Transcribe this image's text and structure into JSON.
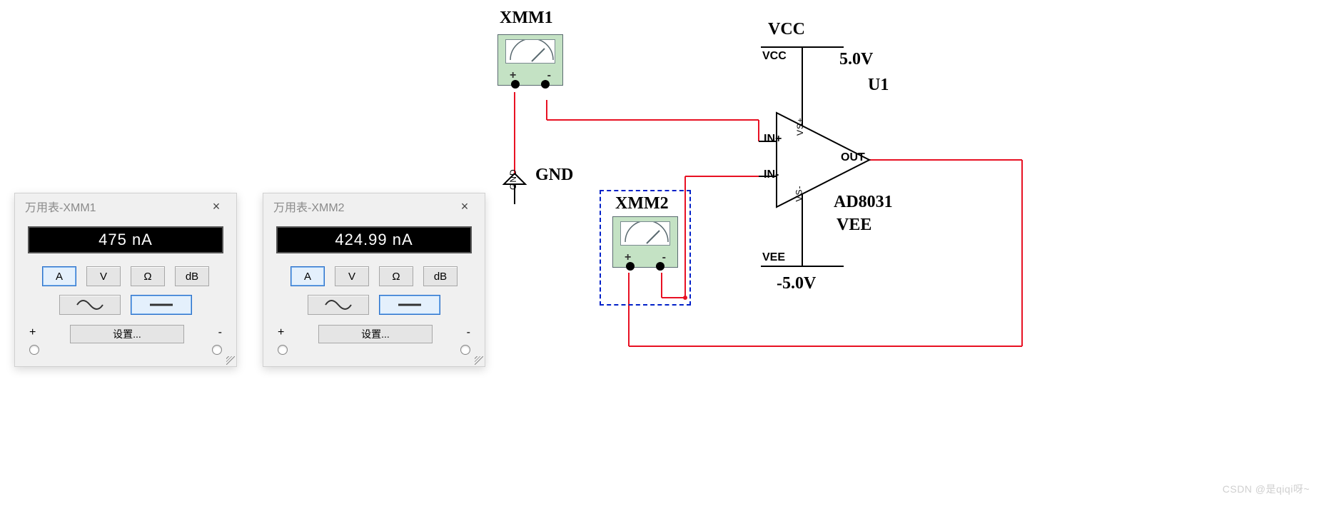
{
  "meters": [
    {
      "key": "xmm1",
      "title": "万用表-XMM1",
      "display": "475 nA",
      "btns_top": [
        "A",
        "V",
        "Ω",
        "dB"
      ],
      "btns_top_active": 0,
      "btns_mode_active": 1,
      "settings_label": "设置...",
      "term_plus": "+",
      "term_minus": "-",
      "close_glyph": "×"
    },
    {
      "key": "xmm2",
      "title": "万用表-XMM2",
      "display": "424.99 nA",
      "btns_top": [
        "A",
        "V",
        "Ω",
        "dB"
      ],
      "btns_top_active": 0,
      "btns_mode_active": 1,
      "settings_label": "设置...",
      "term_plus": "+",
      "term_minus": "-",
      "close_glyph": "×"
    }
  ],
  "circuit": {
    "instr1_label": "XMM1",
    "instr2_label": "XMM2",
    "gnd_label": "GND",
    "gnd_net": "GND",
    "opamp_ref": "U1",
    "opamp_part": "AD8031",
    "vcc_label": "VCC",
    "vcc_net": "VCC",
    "vcc_val": "5.0V",
    "vee_label": "VEE",
    "vee_net": "VEE",
    "vee_val": "-5.0V",
    "pin_in_plus": "IN+",
    "pin_in_minus": "IN-",
    "pin_out": "OUT",
    "pin_vsp": "VS+",
    "pin_vsm": "VS-",
    "instr_plus": "+",
    "instr_minus": "-"
  },
  "watermark": "CSDN @是qiqi呀~"
}
